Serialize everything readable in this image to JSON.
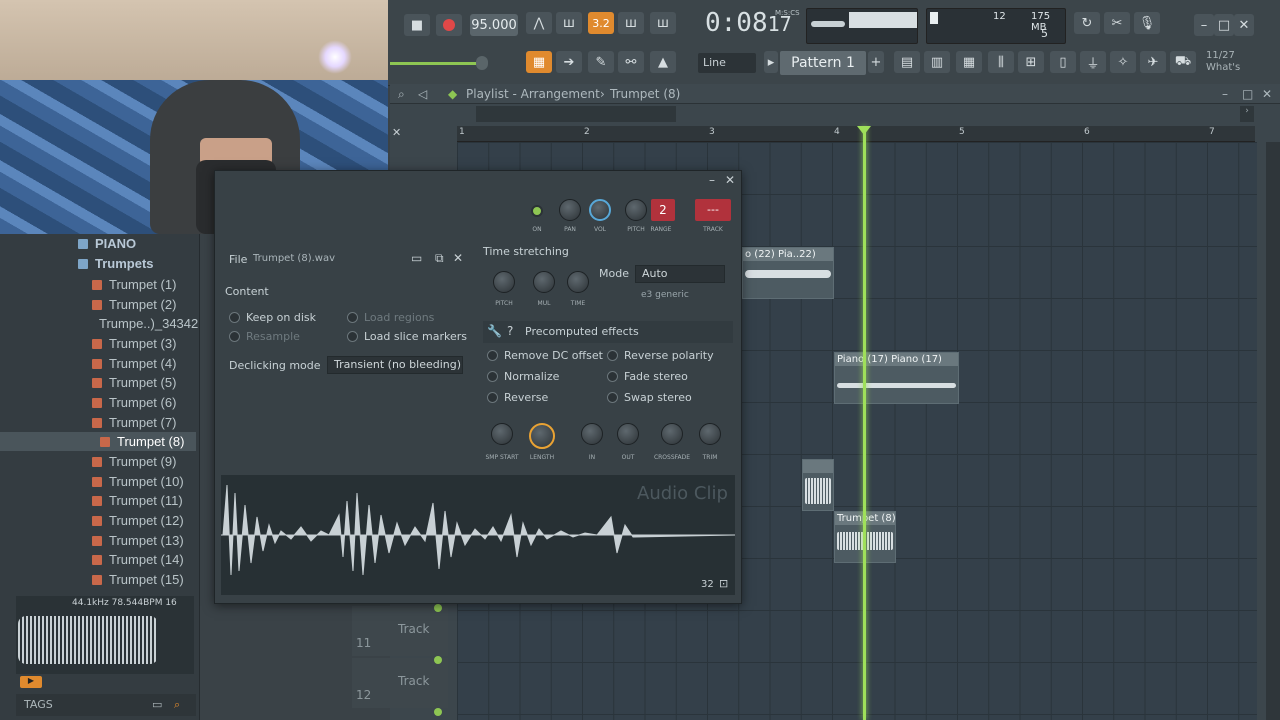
{
  "toolbar": {
    "tempo": "95.000",
    "time_main": "0:08",
    "time_sub_label": "M:S:CS",
    "time_cs": "17",
    "snap_indicator": "3.2",
    "cpu_value": "12",
    "ram_value": "175 MB",
    "poly_value": "5",
    "snap_mode": "Line",
    "pattern_name": "Pattern 1",
    "news_date": "11/27",
    "news_text": "What's"
  },
  "browser": {
    "folders": [
      "PIANO",
      "Trumpets"
    ],
    "items": [
      "Trumpet (1)",
      "Trumpet (2)",
      "Trumpe..)_34342",
      "Trumpet (3)",
      "Trumpet (4)",
      "Trumpet (5)",
      "Trumpet (6)",
      "Trumpet (7)",
      "Trumpet (8)",
      "Trumpet (9)",
      "Trumpet (10)",
      "Trumpet (11)",
      "Trumpet (12)",
      "Trumpet (13)",
      "Trumpet (14)",
      "Trumpet (15)"
    ],
    "selected_item": "Trumpet (8)",
    "sample_info": "44.1kHz 78.544BPM 16",
    "tags_label": "TAGS"
  },
  "playlist": {
    "title_arrow": "Playlist",
    "title": "Playlist - Arrangement",
    "title_sep": "›",
    "crumb": "Trumpet (8)",
    "bars": [
      "1",
      "2",
      "3",
      "4",
      "5",
      "6",
      "7"
    ],
    "clips": {
      "piano22a": "o (22)",
      "piano22b": "Pia..22)",
      "piano17a": "Piano (17)",
      "piano17b": "Piano (17)",
      "trumpet8": "Trumpet (8)"
    },
    "tracks": [
      "Track 11",
      "Track 12"
    ]
  },
  "dialog": {
    "top_labels": {
      "on": "ON",
      "pan": "PAN",
      "vol": "VOL",
      "pitch": "PITCH",
      "range": "RANGE",
      "range_value": "2",
      "track": "TRACK",
      "track_value": "---"
    },
    "file_label": "File",
    "file_name": "Trumpet (8).wav",
    "content_label": "Content",
    "keep_on_disk": "Keep on disk",
    "resample": "Resample",
    "load_regions": "Load regions",
    "load_slice_markers": "Load slice markers",
    "declicking_label": "Declicking mode",
    "declicking_value": "Transient (no bleeding)",
    "time_stretching": "Time stretching",
    "ts_knobs": [
      "PITCH",
      "MUL",
      "TIME"
    ],
    "mode_label": "Mode",
    "mode_value": "Auto",
    "mode_sub": "e3 generic",
    "precomputed": "Precomputed effects",
    "effects_left": [
      "Remove DC offset",
      "Normalize",
      "Reverse"
    ],
    "effects_right": [
      "Reverse polarity",
      "Fade stereo",
      "Swap stereo"
    ],
    "fx_knobs": [
      "SMP START",
      "LENGTH",
      "IN",
      "OUT",
      "CROSSFADE",
      "TRIM"
    ],
    "watermark": "Audio Clip",
    "zoom_value": "32"
  },
  "colors": {
    "accent": "#e08a2e",
    "playhead": "#9fe05a",
    "record": "#e04848"
  }
}
